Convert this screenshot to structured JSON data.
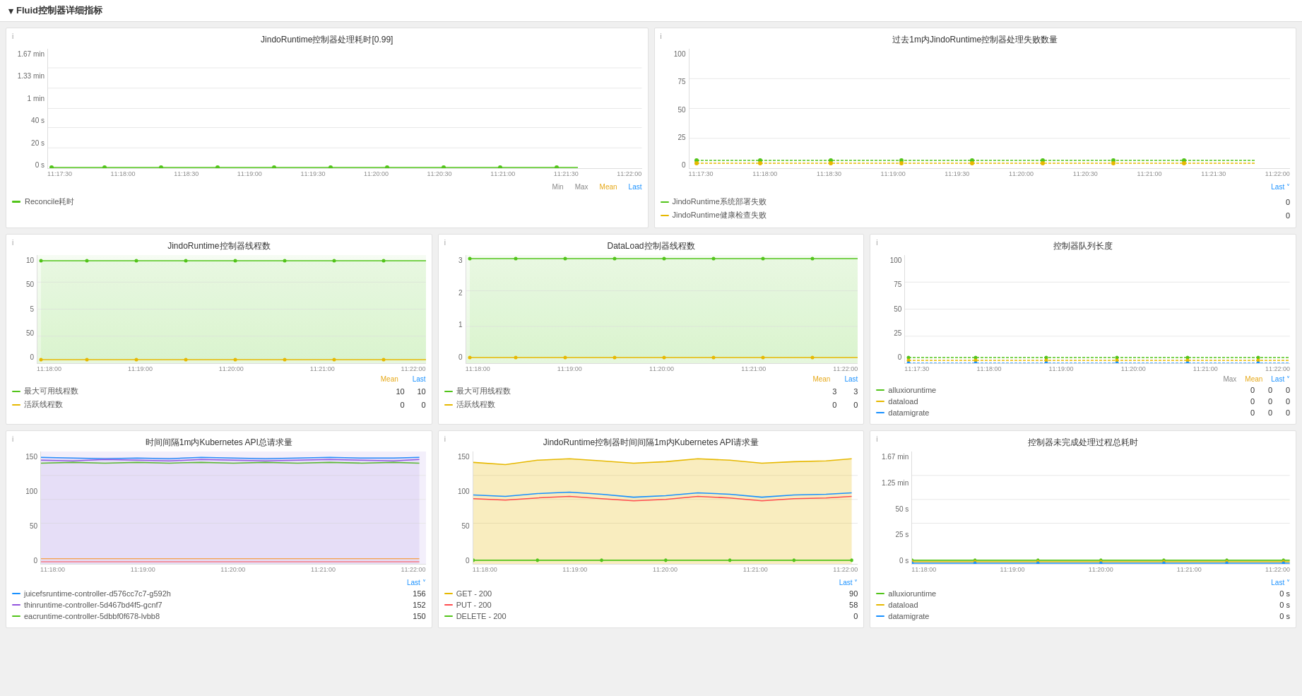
{
  "header": {
    "title": "Fluid控制器详细指标",
    "collapse_icon": "▾"
  },
  "panels": {
    "panel1": {
      "info": "i",
      "title": "JindoRuntime控制器处理耗时[0.99]",
      "y_labels": [
        "1.67 min",
        "1.33 min",
        "1 min",
        "40 s",
        "20 s",
        "0 s"
      ],
      "x_labels": [
        "11:17:30",
        "11:18:00",
        "11:18:30",
        "11:19:00",
        "11:19:30",
        "11:20:00",
        "11:20:30",
        "11:21:00",
        "11:21:30",
        "11:22:00"
      ],
      "legend": [
        {
          "color": "#52c41a",
          "label": "Reconcile耗时",
          "min": "",
          "max": "",
          "mean": "",
          "last": ""
        }
      ],
      "stat_labels": {
        "min": "Min",
        "max": "Max",
        "mean": "Mean",
        "last": "Last"
      }
    },
    "panel2": {
      "info": "i",
      "title": "过去1m内JindoRuntime控制器处理失败数量",
      "y_labels": [
        "100",
        "75",
        "50",
        "25",
        "0"
      ],
      "x_labels": [
        "11:17:30",
        "11:18:00",
        "11:18:30",
        "11:19:00",
        "11:19:30",
        "11:20:00",
        "11:20:30",
        "11:21:00",
        "11:21:30",
        "11:22:00"
      ],
      "last_label": "Last ˅",
      "legend": [
        {
          "color": "#52c41a",
          "label": "JindoRuntime系统部署失败",
          "last": "0"
        },
        {
          "color": "#e6b800",
          "label": "JindoRuntime健康检查失败",
          "last": "0"
        }
      ]
    },
    "panel3": {
      "info": "i",
      "title": "JindoRuntime控制器线程数",
      "y_labels": [
        "10",
        "50",
        "5",
        "50",
        "0"
      ],
      "x_labels": [
        "11:18:00",
        "11:19:00",
        "11:20:00",
        "11:21:00",
        "11:22:00"
      ],
      "stat_labels": {
        "mean": "Mean",
        "last": "Last"
      },
      "legend": [
        {
          "color": "#52c41a",
          "label": "最大可用线程数",
          "mean": "10",
          "last": "10"
        },
        {
          "color": "#e6b800",
          "label": "活跃线程数",
          "mean": "0",
          "last": "0"
        }
      ]
    },
    "panel4": {
      "info": "i",
      "title": "DataLoad控制器线程数",
      "y_labels": [
        "3",
        "2",
        "1",
        "0"
      ],
      "x_labels": [
        "11:18:00",
        "11:19:00",
        "11:20:00",
        "11:21:00",
        "11:22:00"
      ],
      "stat_labels": {
        "mean": "Mean",
        "last": "Last"
      },
      "legend": [
        {
          "color": "#52c41a",
          "label": "最大可用线程数",
          "mean": "3",
          "last": "3"
        },
        {
          "color": "#e6b800",
          "label": "活跃线程数",
          "mean": "0",
          "last": "0"
        }
      ]
    },
    "panel5": {
      "info": "i",
      "title": "控制器队列长度",
      "y_labels": [
        "100",
        "75",
        "50",
        "25",
        "0"
      ],
      "x_labels": [
        "11:17:30",
        "11:18:00",
        "11:18:30",
        "11:19:00",
        "11:19:30",
        "11:20:00",
        "11:20:30",
        "11:21:00",
        "11:21:30",
        "11:22:00"
      ],
      "stat_labels": {
        "max": "Max",
        "mean": "Mean",
        "last": "Last ˅"
      },
      "legend": [
        {
          "color": "#52c41a",
          "label": "alluxioruntime",
          "max": "0",
          "mean": "0",
          "last": "0"
        },
        {
          "color": "#e6b800",
          "label": "dataload",
          "max": "0",
          "mean": "0",
          "last": "0"
        },
        {
          "color": "#1890ff",
          "label": "datamigrate",
          "max": "0",
          "mean": "0",
          "last": "0"
        }
      ]
    },
    "panel6": {
      "info": "i",
      "title": "时间间隔1m内Kubernetes API总请求量",
      "y_labels": [
        "150",
        "100",
        "50",
        "0"
      ],
      "x_labels": [
        "11:18:00",
        "11:19:00",
        "11:20:00",
        "11:21:00",
        "11:22:00"
      ],
      "last_label": "Last ˅",
      "legend": [
        {
          "color": "#1890ff",
          "label": "juicefsruntime-controller-d576cc7c7-g592h",
          "last": "156"
        },
        {
          "color": "#9254de",
          "label": "thinruntime-controller-5d467bd4f5-gcnf7",
          "last": "152"
        },
        {
          "color": "#52c41a",
          "label": "eacruntime-controller-5dbbf0f678-lvbb8",
          "last": "150"
        }
      ]
    },
    "panel7": {
      "info": "i",
      "title": "JindoRuntime控制器时间间隔1m内Kubernetes API请求量",
      "y_labels": [
        "150",
        "100",
        "50",
        "0"
      ],
      "x_labels": [
        "11:18:00",
        "11:19:00",
        "11:20:00",
        "11:21:00",
        "11:22:00"
      ],
      "last_label": "Last ˅",
      "legend": [
        {
          "color": "#e6b800",
          "label": "GET - 200",
          "last": "90"
        },
        {
          "color": "#ff4d4f",
          "label": "PUT - 200",
          "last": "58"
        },
        {
          "color": "#52c41a",
          "label": "DELETE - 200",
          "last": "0"
        }
      ]
    },
    "panel8": {
      "info": "i",
      "title": "控制器未完成处理过程总耗时",
      "y_labels": [
        "1.67 min",
        "1.25 min",
        "50 s",
        "25 s",
        "0 s"
      ],
      "x_labels": [
        "11:18:00",
        "11:19:00",
        "11:20:00",
        "11:21:00",
        "11:22:00"
      ],
      "last_label": "Last ˅",
      "legend": [
        {
          "color": "#52c41a",
          "label": "alluxioruntime",
          "last": "0 s"
        },
        {
          "color": "#e6b800",
          "label": "dataload",
          "last": "0 s"
        },
        {
          "color": "#1890ff",
          "label": "datamigrate",
          "last": "0 s"
        }
      ]
    }
  }
}
